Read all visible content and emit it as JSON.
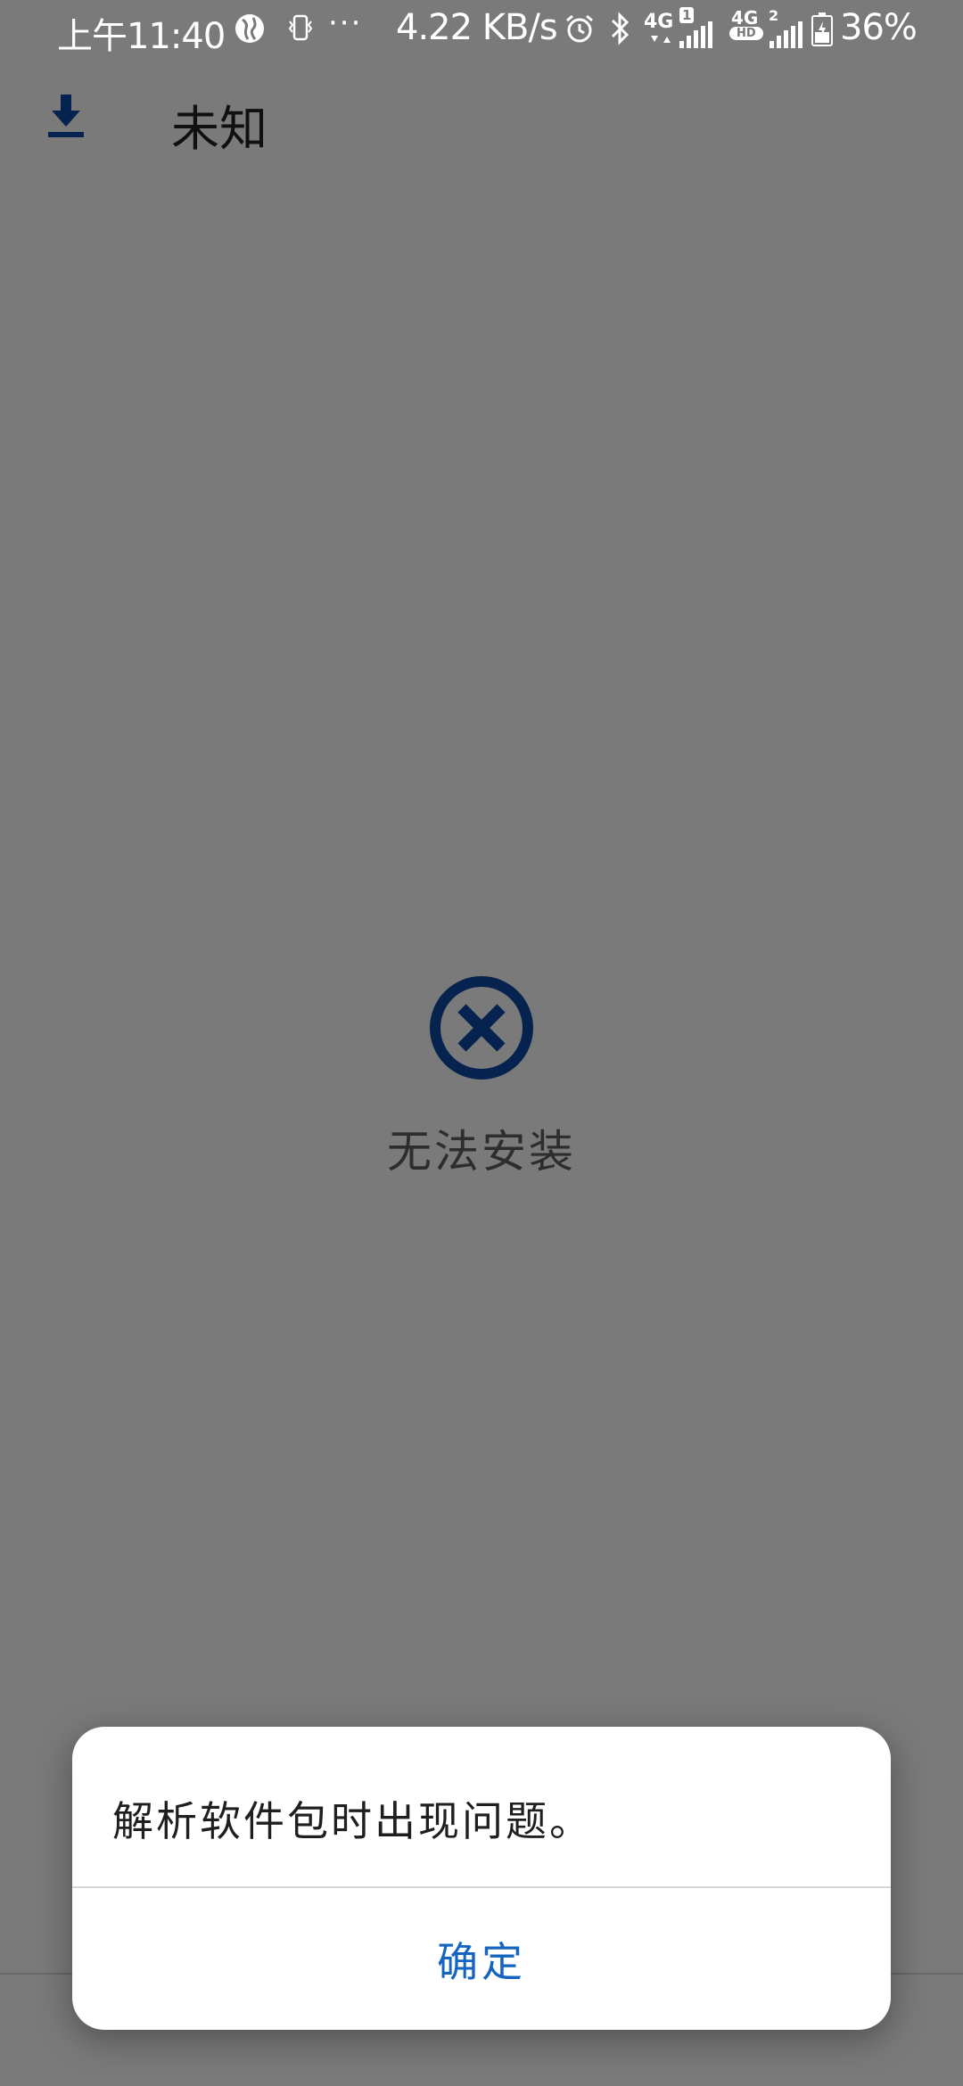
{
  "status_bar": {
    "time": "上午11:40",
    "more": "···",
    "net_speed": "4.22 KB/s",
    "sim1_label": "4G",
    "sim1_badge": "1",
    "sim2_label": "4G",
    "sim2_sub": "HD",
    "sim2_badge": "2",
    "battery": "36%",
    "icons": [
      "globe-icon",
      "vibrate-icon",
      "alarm-icon",
      "bluetooth-icon",
      "signal-icon",
      "battery-icon"
    ]
  },
  "app_bar": {
    "title": "未知",
    "icon": "download-icon"
  },
  "main": {
    "status_icon": "error-circle-x-icon",
    "status_text": "无法安装"
  },
  "dialog": {
    "message": "解析软件包时出现问题。",
    "ok_label": "确定"
  },
  "colors": {
    "accent": "#1565c0",
    "icon_blue": "#0d47a1",
    "background": "#f5f5f5"
  }
}
